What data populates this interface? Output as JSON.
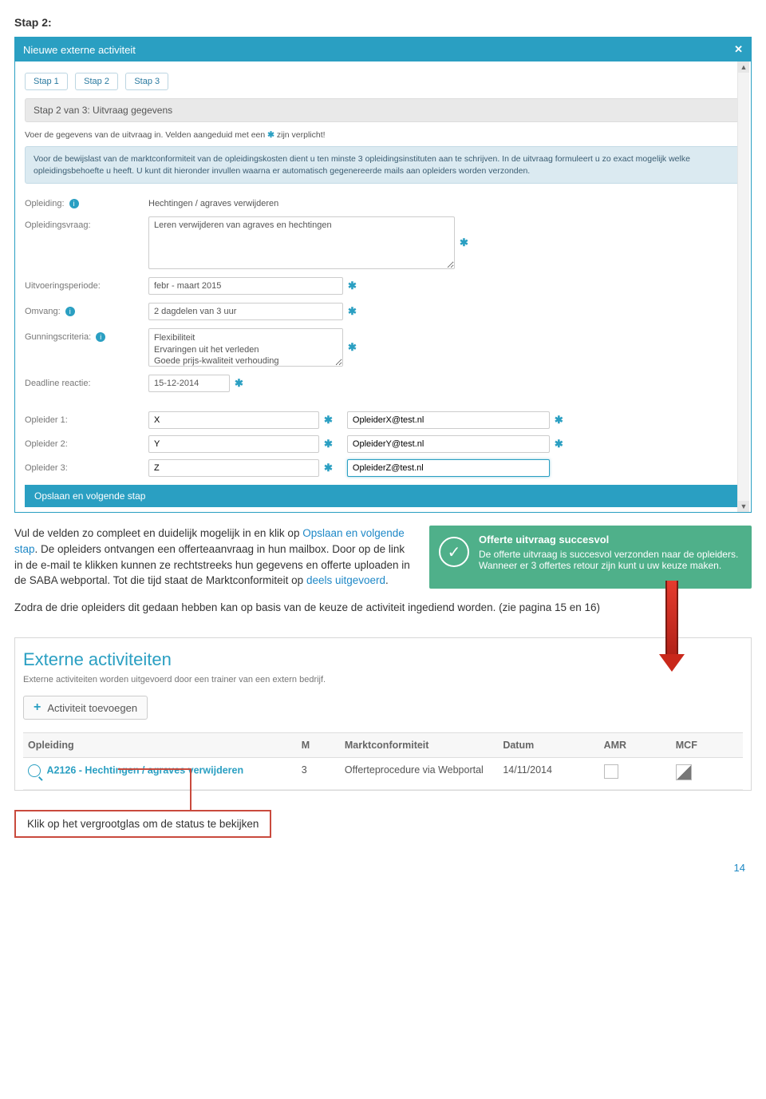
{
  "page": {
    "step_heading": "Stap 2:",
    "number": "14"
  },
  "modal": {
    "title": "Nieuwe externe activiteit",
    "tabs": [
      "Stap 1",
      "Stap 2",
      "Stap 3"
    ],
    "section_title": "Stap 2 van 3: Uitvraag gegevens",
    "required_note_pre": "Voer de gegevens van de uitvraag in. Velden aangeduid met een ",
    "required_note_post": " zijn verplicht!",
    "info_text": "Voor de bewijslast van de marktconformiteit van de opleidingskosten dient u ten minste 3 opleidingsinstituten aan te schrijven. In de uitvraag formuleert u zo exact mogelijk welke opleidingsbehoefte u heeft. U kunt dit hieronder invullen waarna er automatisch gegenereerde mails aan opleiders worden verzonden.",
    "labels": {
      "opleiding": "Opleiding:",
      "opleidingsvraag": "Opleidingsvraag:",
      "uitvoeringsperiode": "Uitvoeringsperiode:",
      "omvang": "Omvang:",
      "gunningscriteria": "Gunningscriteria:",
      "deadline": "Deadline reactie:",
      "opleider1": "Opleider 1:",
      "opleider2": "Opleider 2:",
      "opleider3": "Opleider 3:"
    },
    "values": {
      "opleiding": "Hechtingen / agraves verwijderen",
      "opleidingsvraag": "Leren verwijderen van agraves en hechtingen",
      "uitvoeringsperiode": "febr - maart 2015",
      "omvang": "2 dagdelen van 3 uur",
      "gunningscriteria": "Flexibiliteit\nErvaringen uit het verleden\nGoede prijs-kwaliteit verhouding",
      "deadline": "15-12-2014",
      "opleider1_name": "X",
      "opleider1_email": "OpleiderX@test.nl",
      "opleider2_name": "Y",
      "opleider2_email": "OpleiderY@test.nl",
      "opleider3_name": "Z",
      "opleider3_email": "OpleiderZ@test.nl"
    },
    "submit_label": "Opslaan en volgende stap"
  },
  "explain": {
    "p1_pre": "Vul de velden zo compleet en duidelijk mogelijk in en klik op ",
    "p1_link": "Opslaan en volgende stap",
    "p1_post": ". De opleiders ontvangen een offerteaanvraag in hun mailbox. Door op de link in de e-mail te klikken kunnen ze rechtstreeks hun gegevens en offerte uploaden in de SABA webportal. Tot die tijd staat de Marktconformiteit op ",
    "p1_link2": "deels uitgevoerd",
    "p1_end": ".",
    "p2": "Zodra de drie opleiders dit gedaan hebben kan op basis van de keuze de activiteit ingediend worden. (zie pagina 15 en 16)"
  },
  "success": {
    "title": "Offerte uitvraag succesvol",
    "body": "De offerte uitvraag is succesvol verzonden naar de opleiders. Wanneer er 3 offertes retour zijn kunt u uw keuze maken."
  },
  "tableshot": {
    "title": "Externe activiteiten",
    "subtitle": "Externe activiteiten worden uitgevoerd door een trainer van een extern bedrijf.",
    "add_label": "Activiteit toevoegen",
    "headers": {
      "opleiding": "Opleiding",
      "m": "M",
      "markt": "Marktconformiteit",
      "datum": "Datum",
      "amr": "AMR",
      "mcf": "MCF"
    },
    "row": {
      "code_link": "A2126 - Hechtingen / agraves verwijderen",
      "m": "3",
      "markt": "Offerteprocedure via Webportal",
      "datum": "14/11/2014"
    }
  },
  "callout": "Klik op het vergrootglas om de status te bekijken"
}
